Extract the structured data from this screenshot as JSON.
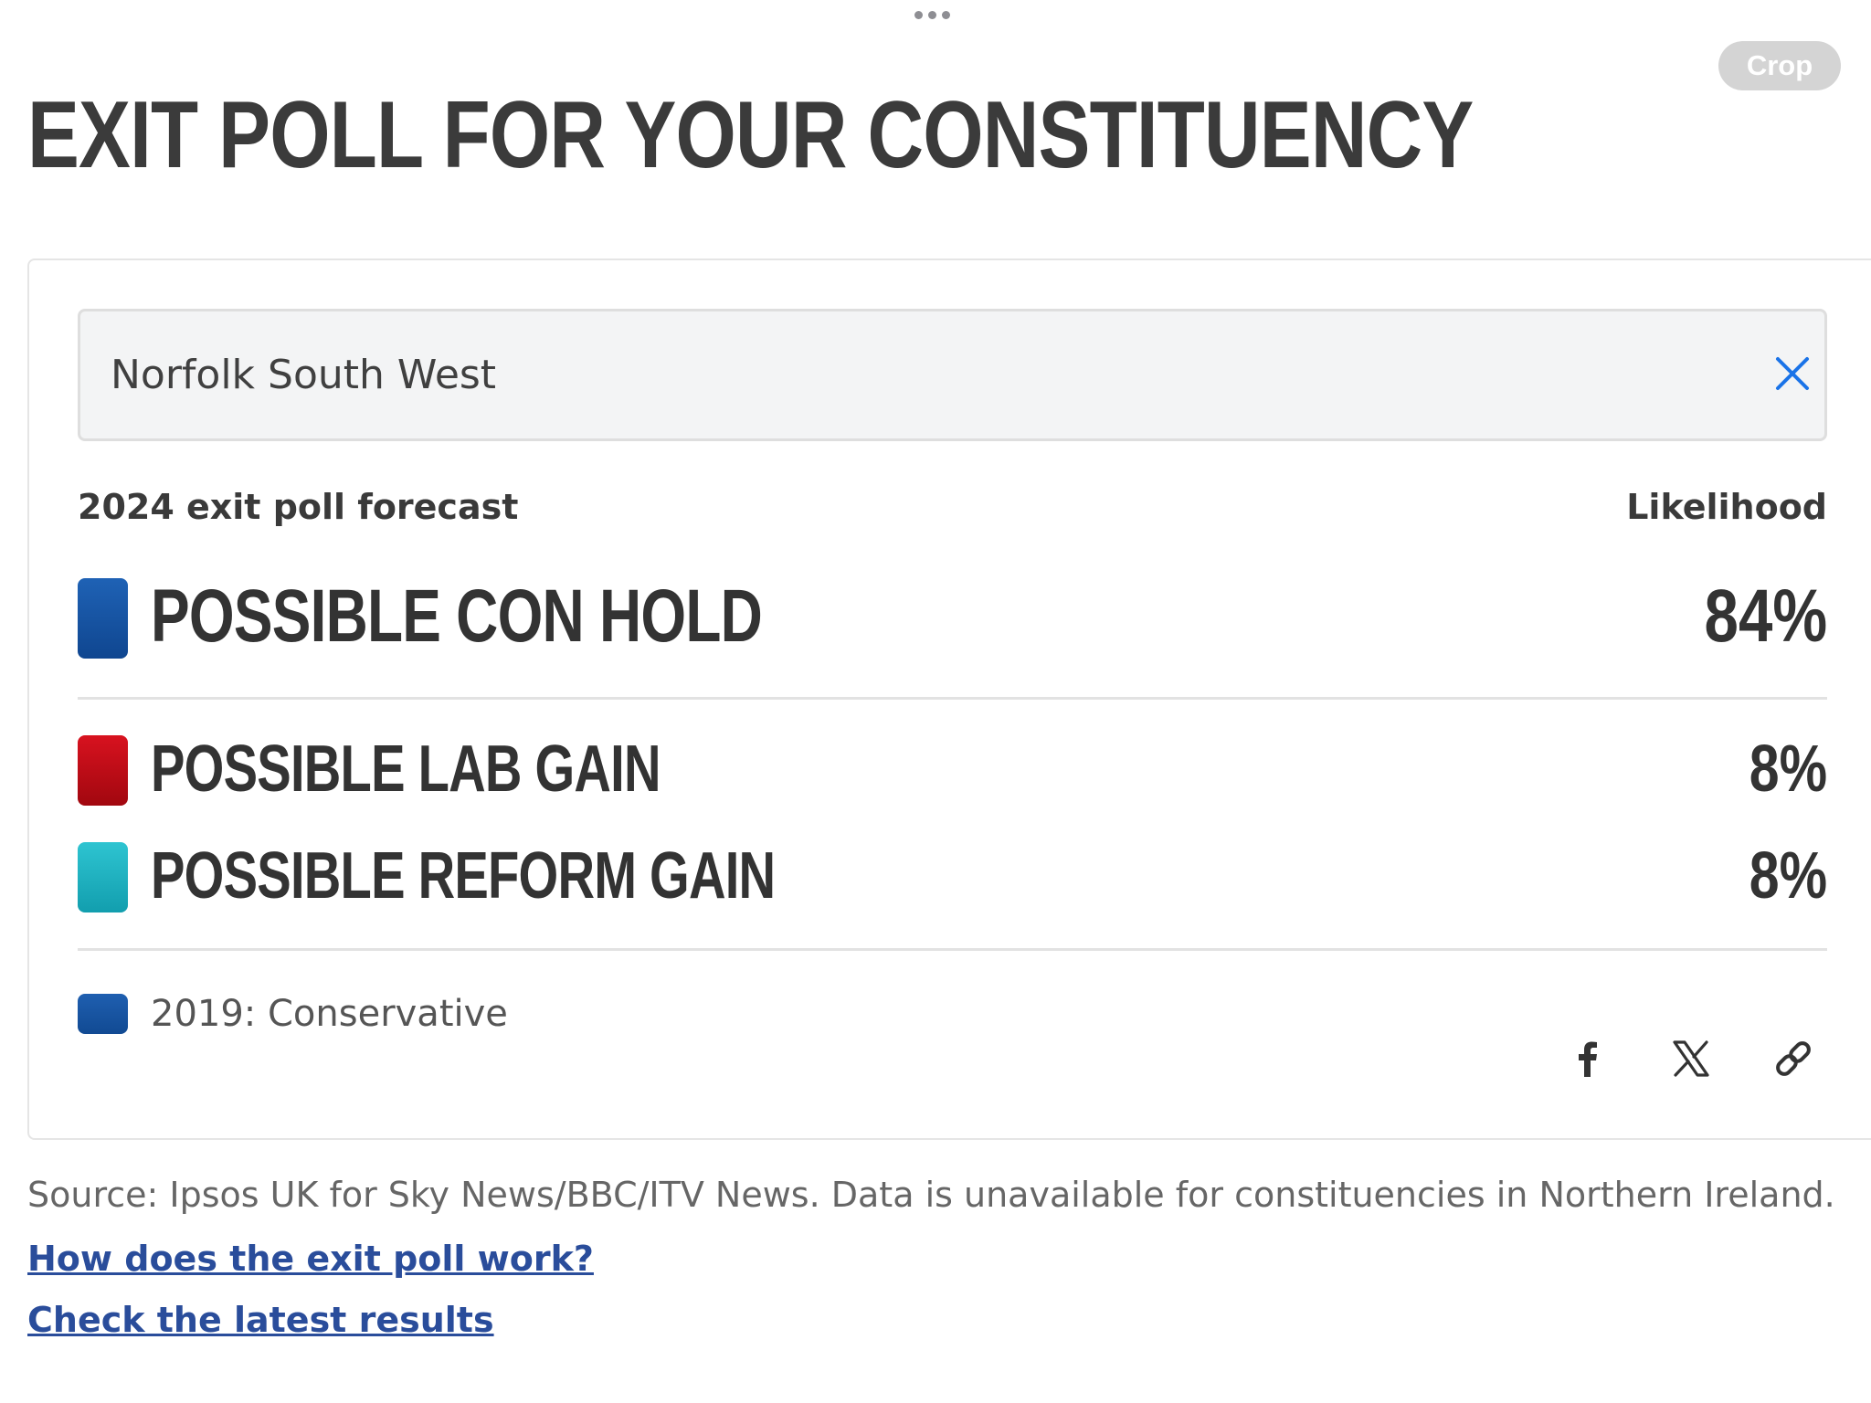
{
  "top_bar": {
    "crop_label": "Crop"
  },
  "page": {
    "title": "EXIT POLL FOR YOUR CONSTITUENCY"
  },
  "search": {
    "value": "Norfolk South West",
    "clear_icon": "close-icon"
  },
  "forecast": {
    "label": "2024 exit poll forecast",
    "likelihood_label": "Likelihood",
    "outcomes": [
      {
        "label": "POSSIBLE CON HOLD",
        "value": "84%",
        "color": "#1656a6"
      },
      {
        "label": "POSSIBLE LAB GAIN",
        "value": "8%",
        "color": "#c8101e"
      },
      {
        "label": "POSSIBLE REFORM GAIN",
        "value": "8%",
        "color": "#1fb5c4"
      }
    ]
  },
  "previous": {
    "label": "2019: Conservative",
    "color": "#1656a6"
  },
  "share": {
    "icons": [
      "facebook-icon",
      "x-icon",
      "link-icon"
    ]
  },
  "footer": {
    "source": "Source: Ipsos UK for Sky News/BBC/ITV News. Data is unavailable for constituencies in Northern Ireland.",
    "link_how": "How does the exit poll work?",
    "link_results": "Check the latest results"
  }
}
